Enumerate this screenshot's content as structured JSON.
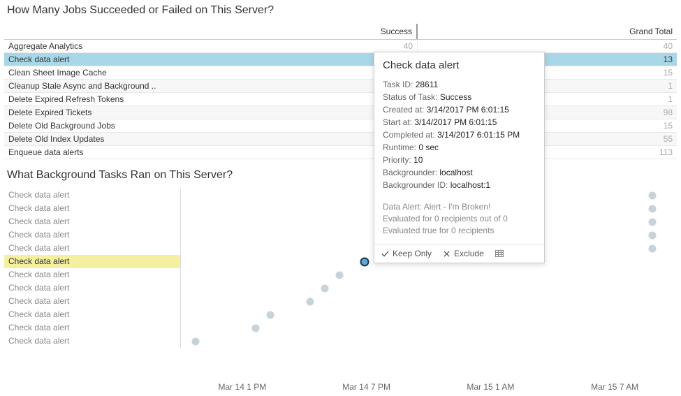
{
  "titles": {
    "jobs": "How Many Jobs Succeeded or Failed on This Server?",
    "tasks": "What Background Tasks Ran on This Server?"
  },
  "columns": {
    "success": "Success",
    "grand": "Grand Total"
  },
  "jobs": [
    {
      "name": "Aggregate Analytics",
      "success": "40",
      "grand": "40",
      "alt": false,
      "selected": false
    },
    {
      "name": "Check data alert",
      "success": "",
      "grand": "13",
      "alt": true,
      "selected": true
    },
    {
      "name": "Clean Sheet Image Cache",
      "success": "",
      "grand": "15",
      "alt": false,
      "selected": false
    },
    {
      "name": "Cleanup Stale Async and Background ..",
      "success": "",
      "grand": "1",
      "alt": true,
      "selected": false
    },
    {
      "name": "Delete Expired Refresh Tokens",
      "success": "",
      "grand": "1",
      "alt": false,
      "selected": false
    },
    {
      "name": "Delete Expired Tickets",
      "success": "",
      "grand": "98",
      "alt": true,
      "selected": false
    },
    {
      "name": "Delete Old Background Jobs",
      "success": "",
      "grand": "15",
      "alt": false,
      "selected": false
    },
    {
      "name": "Delete Old Index Updates",
      "success": "",
      "grand": "55",
      "alt": true,
      "selected": false
    },
    {
      "name": "Enqueue data alerts",
      "success": "",
      "grand": "113",
      "alt": false,
      "selected": false
    }
  ],
  "tasks": [
    {
      "label": "Check data alert",
      "highlight": false
    },
    {
      "label": "Check data alert",
      "highlight": false
    },
    {
      "label": "Check data alert",
      "highlight": false
    },
    {
      "label": "Check data alert",
      "highlight": false
    },
    {
      "label": "Check data alert",
      "highlight": false
    },
    {
      "label": "Check data alert",
      "highlight": true
    },
    {
      "label": "Check data alert",
      "highlight": false
    },
    {
      "label": "Check data alert",
      "highlight": false
    },
    {
      "label": "Check data alert",
      "highlight": false
    },
    {
      "label": "Check data alert",
      "highlight": false
    },
    {
      "label": "Check data alert",
      "highlight": false
    },
    {
      "label": "Check data alert",
      "highlight": false
    }
  ],
  "chart_data": {
    "type": "scatter",
    "xlabel": "",
    "ylabel": "",
    "x_ticks": [
      "Mar 14 1 PM",
      "Mar 14 7 PM",
      "Mar 15 1 AM",
      "Mar 15 7 AM"
    ],
    "series": [
      {
        "name": "Check data alert",
        "points": [
          {
            "row": 0,
            "x_pct": 95,
            "selected": false
          },
          {
            "row": 1,
            "x_pct": 95,
            "selected": false
          },
          {
            "row": 2,
            "x_pct": 95,
            "selected": false
          },
          {
            "row": 3,
            "x_pct": 95,
            "selected": false
          },
          {
            "row": 4,
            "x_pct": 95,
            "selected": false
          },
          {
            "row": 5,
            "x_pct": 37,
            "selected": true
          },
          {
            "row": 6,
            "x_pct": 32,
            "selected": false
          },
          {
            "row": 7,
            "x_pct": 29,
            "selected": false
          },
          {
            "row": 8,
            "x_pct": 26,
            "selected": false
          },
          {
            "row": 9,
            "x_pct": 18,
            "selected": false
          },
          {
            "row": 10,
            "x_pct": 15,
            "selected": false
          },
          {
            "row": 11,
            "x_pct": 3,
            "selected": false
          }
        ]
      }
    ]
  },
  "tooltip": {
    "title": "Check data alert",
    "fields": {
      "task_id_label": "Task ID:",
      "task_id": "28611",
      "status_label": "Status of Task:",
      "status": "Success",
      "created_label": "Created at:",
      "created": "3/14/2017 PM 6:01:15",
      "start_label": "Start at:",
      "start": "3/14/2017 PM 6:01:15",
      "completed_label": "Completed at:",
      "completed": "3/14/2017 6:01:15 PM",
      "runtime_label": "Runtime:",
      "runtime": "0 sec",
      "priority_label": "Priority:",
      "priority": "10",
      "backgrounder_label": "Backgrounder:",
      "backgrounder": "localhost",
      "backgrounder_id_label": "Backgrounder ID:",
      "backgrounder_id": "localhost:1"
    },
    "extra": [
      "Data Alert: Alert - I'm Broken!",
      "Evaluated for 0 recipients out of 0",
      "Evaluated true for 0 recipients"
    ],
    "actions": {
      "keep": "Keep Only",
      "exclude": "Exclude"
    }
  }
}
